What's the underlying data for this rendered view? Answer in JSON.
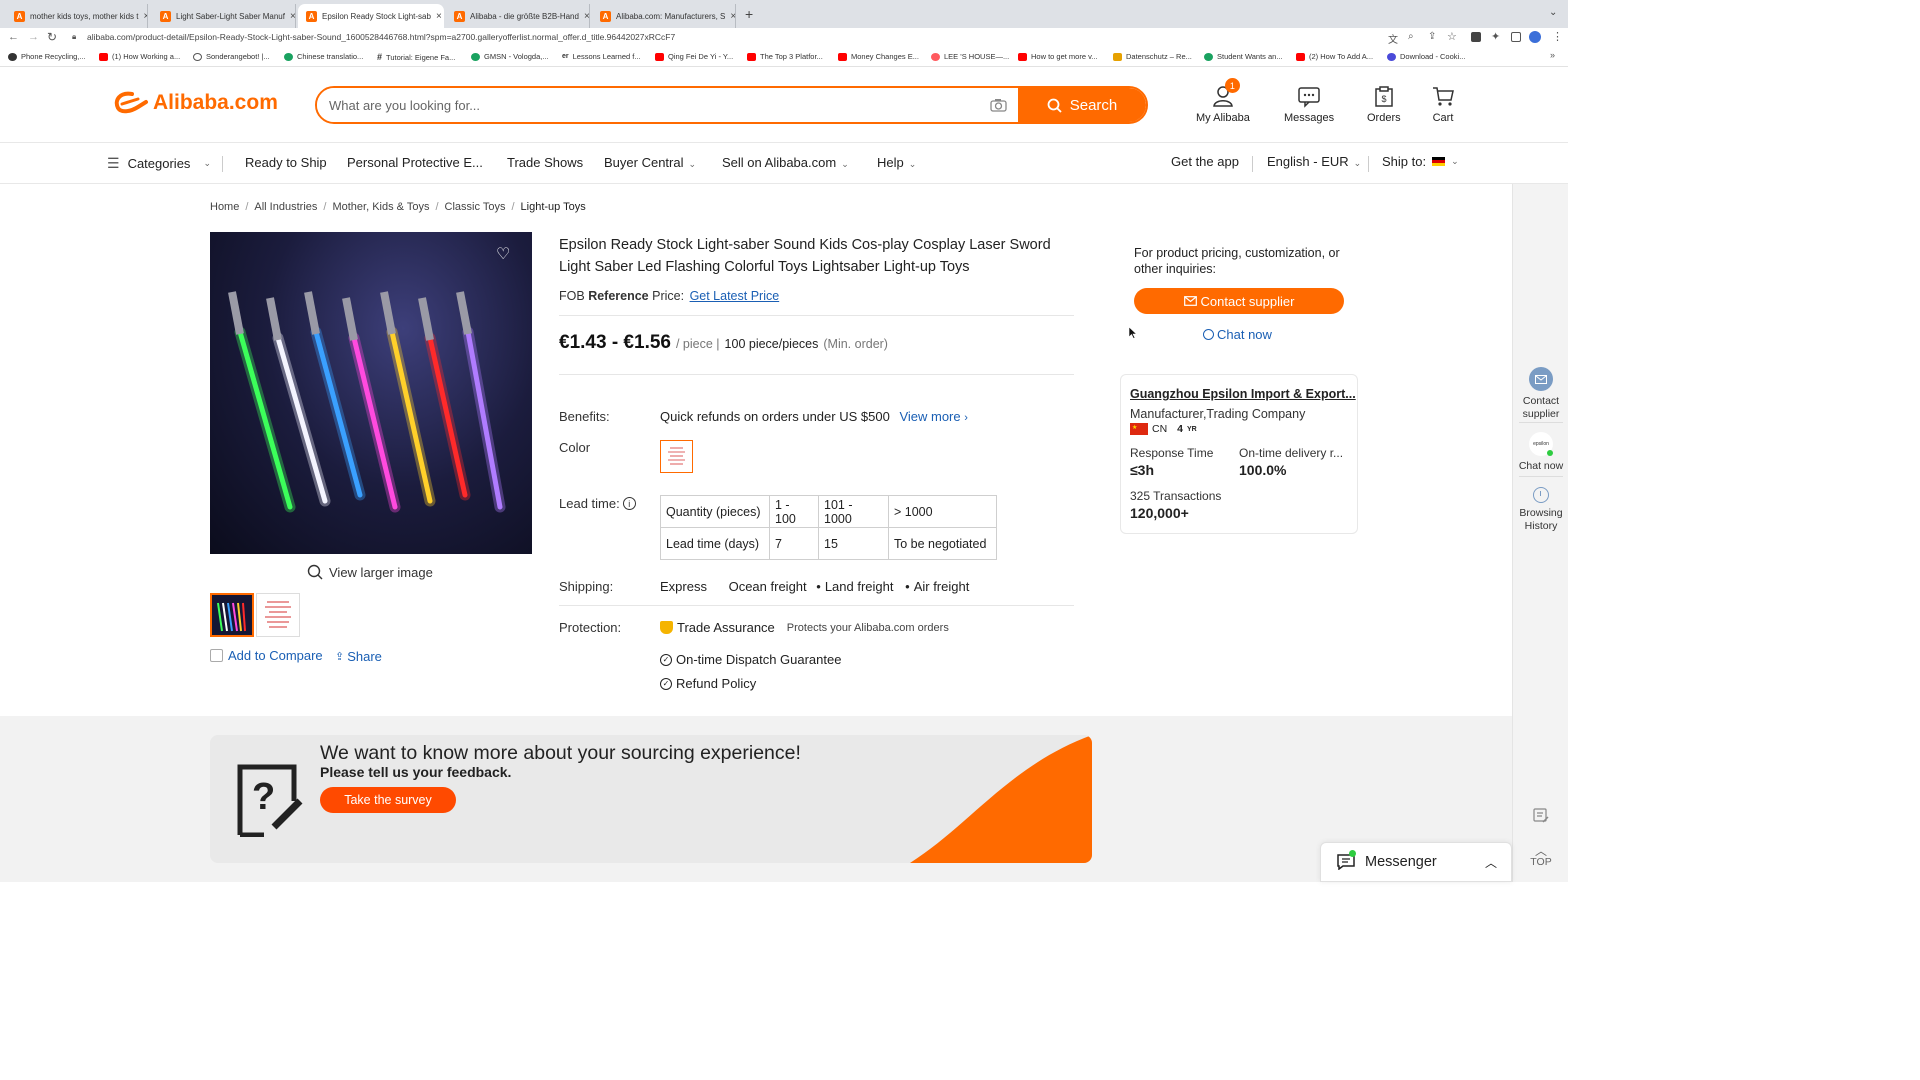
{
  "browser": {
    "tabs": [
      {
        "title": "mother kids toys, mother kids t",
        "active": false
      },
      {
        "title": "Light Saber-Light Saber Manuf",
        "active": false
      },
      {
        "title": "Epsilon Ready Stock Light-sab",
        "active": true
      },
      {
        "title": "Alibaba - die größte B2B-Hand",
        "active": false
      },
      {
        "title": "Alibaba.com: Manufacturers, S",
        "active": false
      }
    ],
    "new_tab": "+",
    "url": "alibaba.com/product-detail/Epsilon-Ready-Stock-Light-saber-Sound_1600528446768.html?spm=a2700.galleryofferlist.normal_offer.d_title.96442027xRCcF7",
    "bookmarks": [
      {
        "label": "Phone Recycling,...",
        "color": "#333333"
      },
      {
        "label": "(1) How Working a...",
        "color": "#ff0000"
      },
      {
        "label": "Sonderangebot! |...",
        "color": "#555555"
      },
      {
        "label": "Chinese translatio...",
        "color": "#1aa260"
      },
      {
        "label": "Tutorial: Eigene Fa...",
        "color": "#333333"
      },
      {
        "label": "GMSN - Vologda,...",
        "color": "#1aa260"
      },
      {
        "label": "Lessons Learned f...",
        "color": "#333333"
      },
      {
        "label": "Qing Fei De Yi - Y...",
        "color": "#ff0000"
      },
      {
        "label": "The Top 3 Platfor...",
        "color": "#ff0000"
      },
      {
        "label": "Money Changes E...",
        "color": "#ff0000"
      },
      {
        "label": "LEE 'S HOUSE—...",
        "color": "#ff5a5f"
      },
      {
        "label": "How to get more v...",
        "color": "#ff0000"
      },
      {
        "label": "Datenschutz – Re...",
        "color": "#e6a100"
      },
      {
        "label": "Student Wants an...",
        "color": "#1aa260"
      },
      {
        "label": "(2) How To Add A...",
        "color": "#ff0000"
      },
      {
        "label": "Download - Cooki...",
        "color": "#4a4ad9"
      }
    ]
  },
  "header": {
    "logo_text": "Alibaba.com",
    "search_placeholder": "What are you looking for...",
    "search_button": "Search",
    "icons": [
      {
        "label": "My Alibaba",
        "icon": "user-icon",
        "badge": "1"
      },
      {
        "label": "Messages",
        "icon": "chat-bubble-icon"
      },
      {
        "label": "Orders",
        "icon": "orders-icon"
      },
      {
        "label": "Cart",
        "icon": "cart-icon"
      }
    ]
  },
  "nav": {
    "categories": "Categories",
    "items": [
      "Ready to Ship",
      "Personal Protective E...",
      "Trade Shows",
      "Buyer Central",
      "Sell on Alibaba.com",
      "Help"
    ],
    "get_app": "Get the app",
    "language": "English - EUR",
    "ship_to": "Ship to:"
  },
  "breadcrumb": [
    "Home",
    "All Industries",
    "Mother, Kids & Toys",
    "Classic Toys",
    "Light-up Toys"
  ],
  "product": {
    "title": "Epsilon Ready Stock Light-saber Sound Kids Cos-play Cosplay Laser Sword Light Saber Led Flashing Colorful Toys Lightsaber Light-up Toys",
    "fob_prefix": "FOB",
    "fob_bold": "Reference",
    "fob_suffix": "Price:",
    "latest_price_link": "Get Latest Price",
    "price": "€1.43 - €1.56",
    "unit": "/ piece |",
    "moq": "100 piece/pieces",
    "moq_note": "(Min. order)",
    "benefits_label": "Benefits:",
    "benefits_text": "Quick refunds on orders under US $500",
    "view_more": "View more",
    "color_label": "Color",
    "lead_time_label": "Lead time:",
    "lead_time_table": {
      "headers": [
        "Quantity (pieces)",
        "1 - 100",
        "101 - 1000",
        "> 1000"
      ],
      "values": [
        "Lead time (days)",
        "7",
        "15",
        "To be negotiated"
      ]
    },
    "shipping_label": "Shipping:",
    "shipping_options": [
      "Express",
      "Ocean freight",
      "Land freight",
      "Air freight"
    ],
    "protection_label": "Protection:",
    "trade_assurance": "Trade Assurance",
    "trade_assurance_note": "Protects your Alibaba.com orders",
    "guarantees": [
      "On-time Dispatch Guarantee",
      "Refund Policy"
    ],
    "view_larger": "View larger image",
    "add_compare": "Add to Compare",
    "share": "Share",
    "saber_colors": [
      "#3cff5a",
      "#f4f4ff",
      "#3aa0ff",
      "#ff4adf",
      "#ffd02a",
      "#ff2a2a",
      "#b07cff"
    ]
  },
  "supplier": {
    "inquiry_text": "For product pricing, customization, or other inquiries:",
    "contact_button": "Contact supplier",
    "chat_now": "Chat now",
    "name": "Guangzhou Epsilon Import & Export...",
    "type": "Manufacturer,Trading Company",
    "country": "CN",
    "years": "4",
    "years_unit": "YR",
    "response_label": "Response Time",
    "response_value": "≤3h",
    "ontime_label": "On-time delivery r...",
    "ontime_value": "100.0%",
    "transactions_label": "325 Transactions",
    "transactions_value": "120,000+"
  },
  "sidebar": {
    "contact": "Contact supplier",
    "chat": "Chat now",
    "history": "Browsing History",
    "top": "TOP",
    "avatar_text": "epsilon"
  },
  "survey": {
    "title": "We want to know more about your sourcing experience!",
    "subtitle": "Please tell us your feedback.",
    "button": "Take the survey"
  },
  "messenger": {
    "label": "Messenger"
  },
  "colors": {
    "brand": "#ff6a00",
    "link": "#1a5fb4"
  }
}
